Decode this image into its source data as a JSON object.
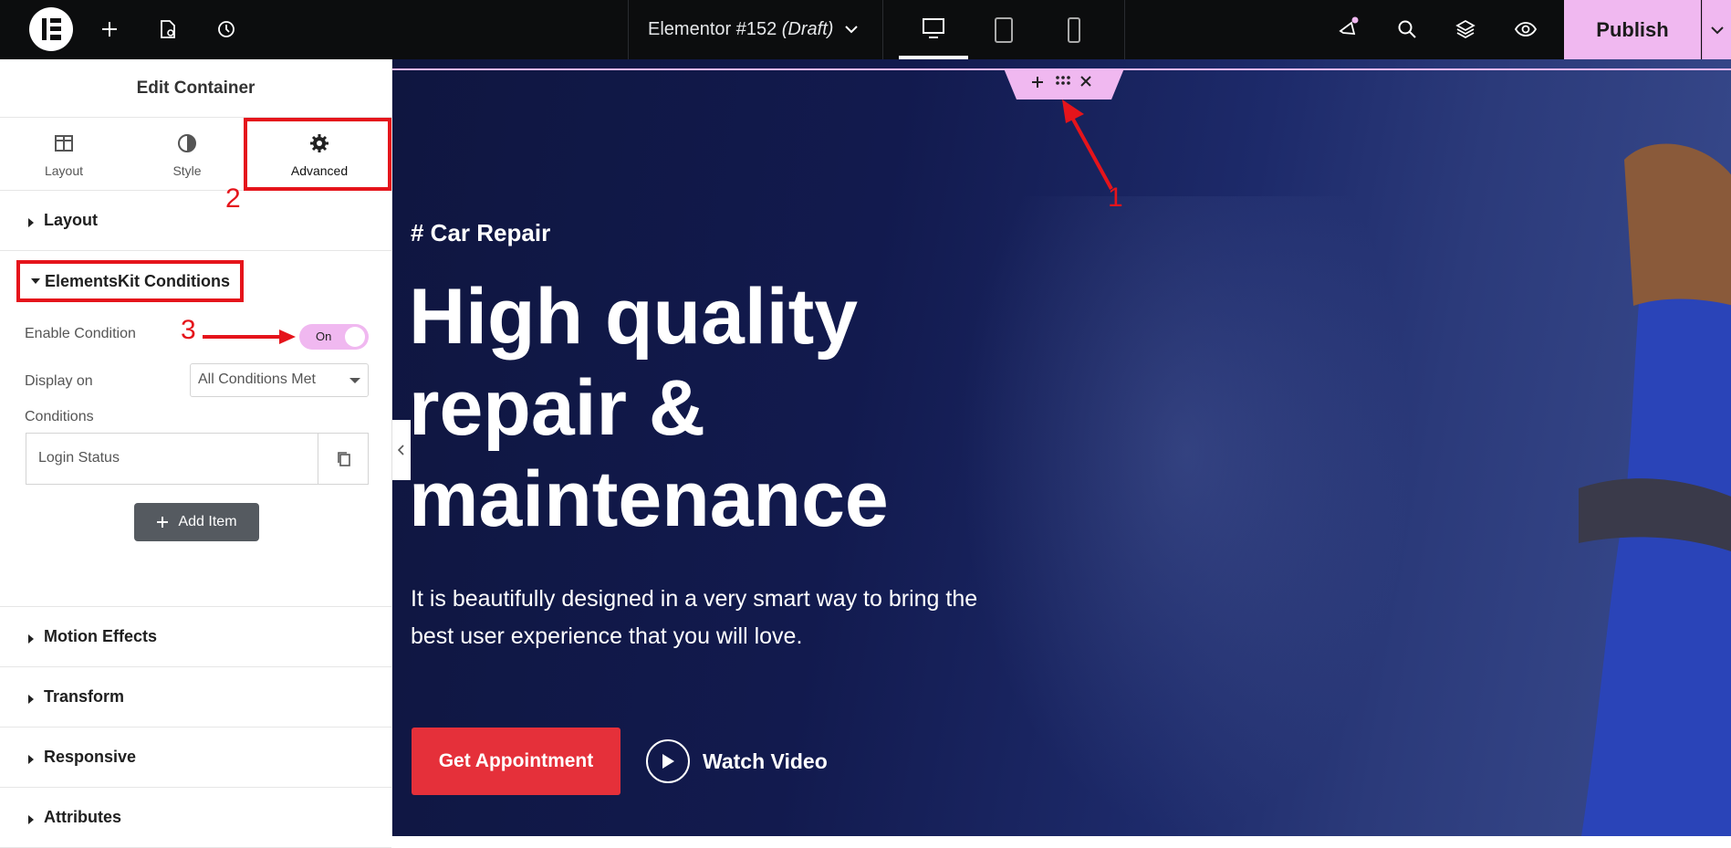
{
  "topbar": {
    "doc_title": "Elementor #152",
    "doc_status": "(Draft)",
    "publish_label": "Publish"
  },
  "sidebar": {
    "panel_title": "Edit Container",
    "tabs": [
      {
        "label": "Layout",
        "icon": "columns-icon"
      },
      {
        "label": "Style",
        "icon": "half-circle-icon"
      },
      {
        "label": "Advanced",
        "icon": "gear-icon"
      }
    ],
    "sections": {
      "layout": "Layout",
      "elementskit": "ElementsKit Conditions",
      "motion": "Motion Effects",
      "transform": "Transform",
      "responsive": "Responsive",
      "attributes": "Attributes"
    },
    "enable_condition_label": "Enable Condition",
    "toggle_label": "On",
    "display_on_label": "Display on",
    "display_on_value": "All Conditions Met",
    "conditions_label": "Conditions",
    "condition_item": "Login Status",
    "add_item_label": "Add Item"
  },
  "annotations": {
    "n1": "1",
    "n2": "2",
    "n3": "3",
    "color": "#e5141b"
  },
  "canvas": {
    "eyebrow": "# Car Repair",
    "title_lines": [
      "High quality",
      "repair &",
      "maintenance"
    ],
    "subtitle_lines": [
      "It is beautifully designed in a very smart way to bring the",
      "best user experience that you will love."
    ],
    "cta_label": "Get Appointment",
    "watch_label": "Watch Video"
  },
  "colors": {
    "accent_pink": "#f0b8f0",
    "cta_red": "#e5303a",
    "topbar_bg": "#0c0d0e"
  }
}
